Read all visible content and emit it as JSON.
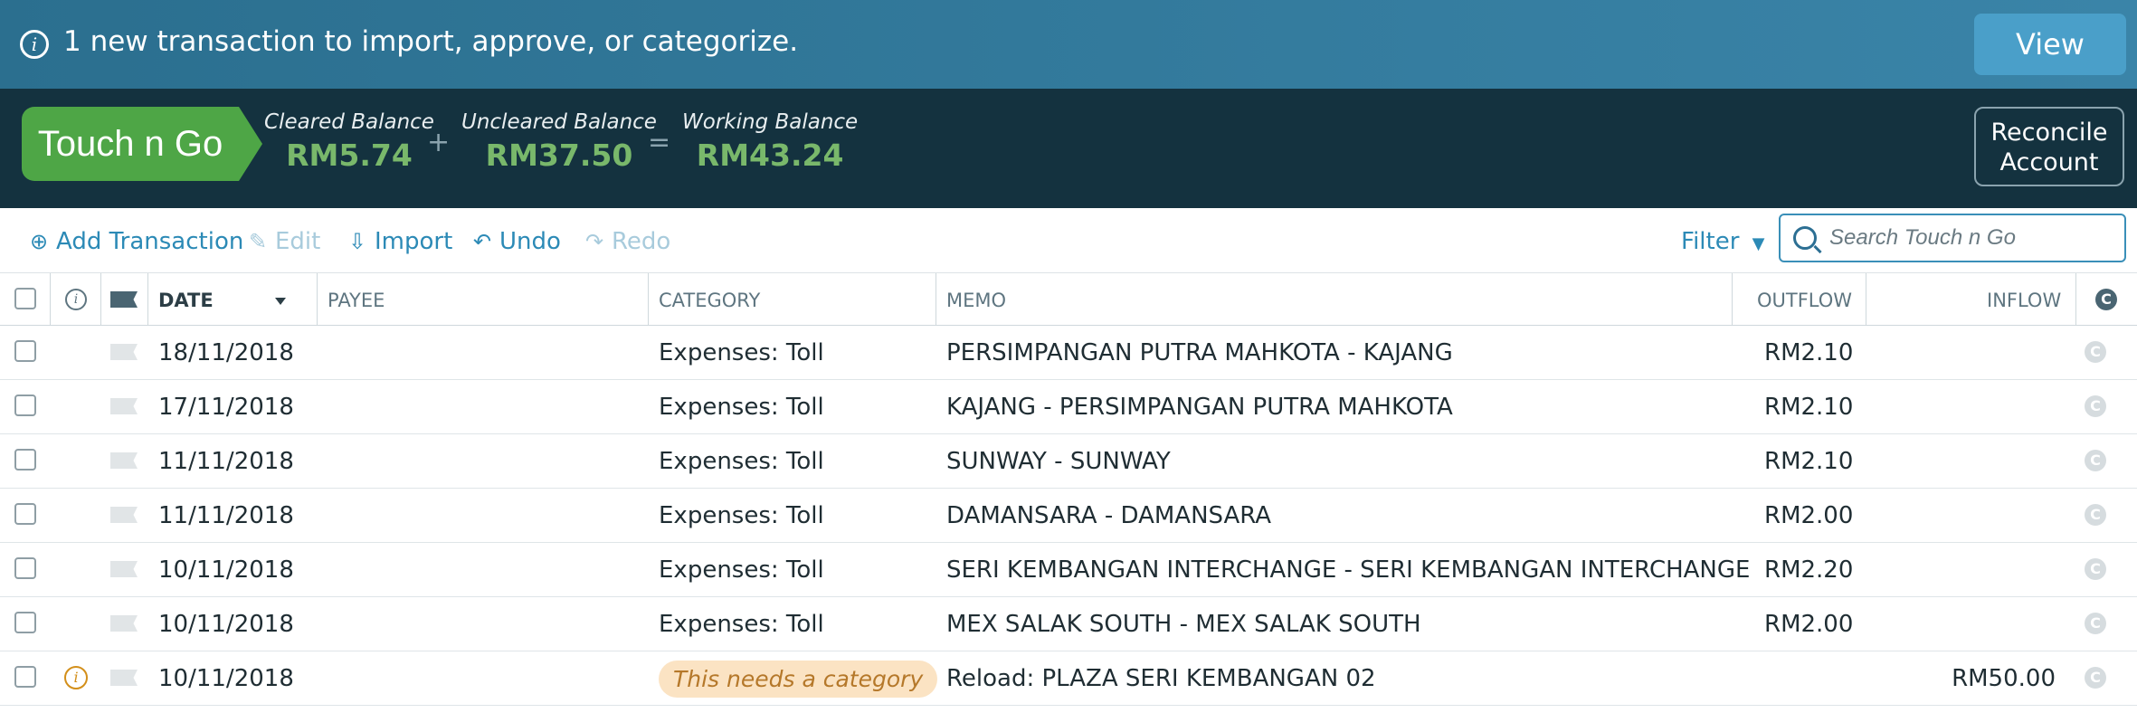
{
  "notice": {
    "message": "1 new transaction to import, approve, or categorize.",
    "view_label": "View"
  },
  "account": {
    "name": "Touch n Go",
    "cleared_label": "Cleared Balance",
    "cleared_amount": "RM5.74",
    "uncleared_label": "Uncleared Balance",
    "uncleared_amount": "RM37.50",
    "working_label": "Working Balance",
    "working_amount": "RM43.24",
    "plus": "+",
    "equals": "=",
    "reconcile_label_1": "Reconcile",
    "reconcile_label_2": "Account"
  },
  "toolbar": {
    "add": "Add Transaction",
    "edit": "Edit",
    "import": "Import",
    "undo": "Undo",
    "redo": "Redo",
    "filter": "Filter",
    "search_placeholder": "Search Touch n Go"
  },
  "columns": {
    "date": "DATE",
    "payee": "PAYEE",
    "category": "CATEGORY",
    "memo": "MEMO",
    "outflow": "OUTFLOW",
    "inflow": "INFLOW"
  },
  "rows": [
    {
      "date": "18/11/2018",
      "category": "Expenses: Toll",
      "memo": "PERSIMPANGAN PUTRA MAHKOTA - KAJANG",
      "outflow": "RM2.10",
      "inflow": ""
    },
    {
      "date": "17/11/2018",
      "category": "Expenses: Toll",
      "memo": "KAJANG - PERSIMPANGAN PUTRA MAHKOTA",
      "outflow": "RM2.10",
      "inflow": ""
    },
    {
      "date": "11/11/2018",
      "category": "Expenses: Toll",
      "memo": "SUNWAY - SUNWAY",
      "outflow": "RM2.10",
      "inflow": ""
    },
    {
      "date": "11/11/2018",
      "category": "Expenses: Toll",
      "memo": "DAMANSARA - DAMANSARA",
      "outflow": "RM2.00",
      "inflow": ""
    },
    {
      "date": "10/11/2018",
      "category": "Expenses: Toll",
      "memo": "SERI KEMBANGAN INTERCHANGE - SERI KEMBANGAN INTERCHANGE",
      "outflow": "RM2.20",
      "inflow": ""
    },
    {
      "date": "10/11/2018",
      "category": "Expenses: Toll",
      "memo": "MEX SALAK SOUTH - MEX SALAK SOUTH",
      "outflow": "RM2.00",
      "inflow": ""
    },
    {
      "date": "10/11/2018",
      "category": "This needs a category",
      "memo": "Reload: PLAZA SERI KEMBANGAN 02",
      "outflow": "",
      "inflow": "RM50.00"
    }
  ],
  "cleared_symbol": "C",
  "colors": {
    "notice_bg": "#2b6f8f",
    "header_bg": "#14323f",
    "account_badge": "#4ea646",
    "balance_green": "#79b86b",
    "link_blue": "#2c8ab6",
    "warning": "#d38f1a"
  }
}
